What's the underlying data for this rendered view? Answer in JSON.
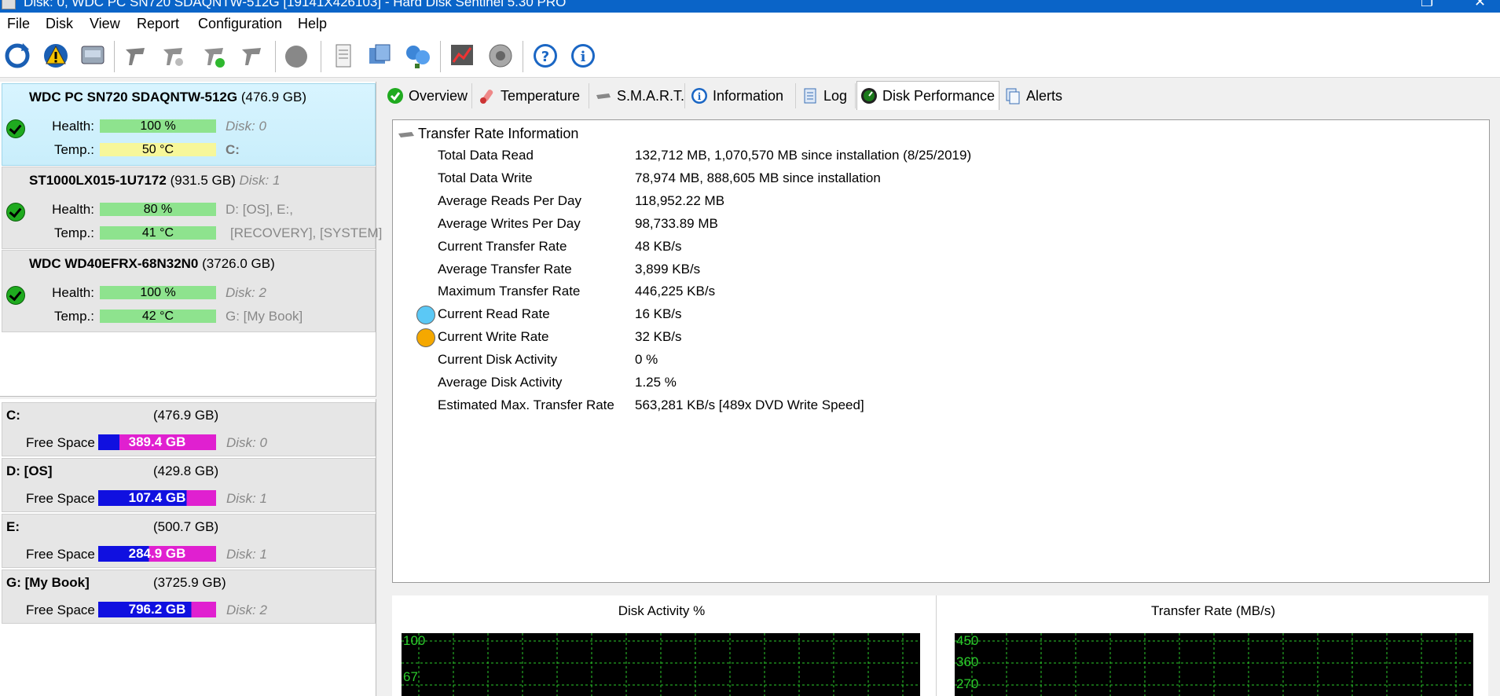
{
  "window": {
    "title": "Disk: 0, WDC PC SN720 SDAQNTW-512G [19141X426103]  -  Hard Disk Sentinel 5.30 PRO"
  },
  "menu": [
    "File",
    "Disk",
    "View",
    "Report",
    "Configuration",
    "Help"
  ],
  "toolbar": {
    "buttons": [
      "refresh-icon",
      "alert-icon",
      "disk-icon",
      "tool-icon",
      "tool-icon",
      "tool-icon",
      "tool-icon",
      "power-icon",
      "document-icon",
      "sync-icon",
      "network-icon",
      "chart-icon",
      "speaker-icon",
      "help-icon",
      "info-icon"
    ]
  },
  "disks": [
    {
      "name": "WDC PC SN720 SDAQNTW-512G",
      "size": "(476.9 GB)",
      "health_label": "Health:",
      "health": "100 %",
      "health_pct": 100,
      "temp_label": "Temp.:",
      "temp": "50 °C",
      "disk_no": "Disk: 0",
      "drives": "C:",
      "status": "ok"
    },
    {
      "name": "ST1000LX015-1U7172",
      "size": "(931.5 GB)",
      "disk_no": "Disk: 1",
      "health_label": "Health:",
      "health": "80 %",
      "health_pct": 80,
      "temp_label": "Temp.:",
      "temp": "41 °C",
      "drives_line1": "D: [OS], E:,",
      "drives_line2": "[RECOVERY],  [SYSTEM]",
      "status": "ok"
    },
    {
      "name": "WDC WD40EFRX-68N32N0",
      "size": "(3726.0 GB)",
      "health_label": "Health:",
      "health": "100 %",
      "health_pct": 100,
      "temp_label": "Temp.:",
      "temp": "42 °C",
      "disk_no": "Disk: 2",
      "drives": "G: [My Book]",
      "status": "ok"
    }
  ],
  "volumes": [
    {
      "name": "C:",
      "size": "(476.9 GB)",
      "free_label": "Free Space",
      "free": "389.4 GB",
      "free_pct": 82,
      "disk": "Disk: 0"
    },
    {
      "name": "D: [OS]",
      "size": "(429.8 GB)",
      "free_label": "Free Space",
      "free": "107.4 GB",
      "free_pct": 25,
      "disk": "Disk: 1"
    },
    {
      "name": "E:",
      "size": "(500.7 GB)",
      "free_label": "Free Space",
      "free": "284.9 GB",
      "free_pct": 57,
      "disk": "Disk: 1"
    },
    {
      "name": "G: [My Book]",
      "size": "(3725.9 GB)",
      "free_label": "Free Space",
      "free": "796.2 GB",
      "free_pct": 21,
      "disk": "Disk: 2"
    }
  ],
  "tabs": [
    {
      "label": "Overview",
      "active": false
    },
    {
      "label": "Temperature",
      "active": false
    },
    {
      "label": "S.M.A.R.T.",
      "active": false
    },
    {
      "label": "Information",
      "active": false
    },
    {
      "label": "Log",
      "active": false
    },
    {
      "label": "Disk Performance",
      "active": true
    },
    {
      "label": "Alerts",
      "active": false
    }
  ],
  "transfer": {
    "heading": "Transfer Rate Information",
    "rows": [
      {
        "k": "Total Data Read",
        "v": "132,712 MB,  1,070,570 MB since installation  (8/25/2019)"
      },
      {
        "k": "Total Data Write",
        "v": "78,974 MB,  888,605 MB since installation"
      },
      {
        "k": "Average Reads Per Day",
        "v": "118,952.22 MB"
      },
      {
        "k": "Average Writes Per Day",
        "v": "98,733.89 MB"
      },
      {
        "k": "Current Transfer Rate",
        "v": "48 KB/s"
      },
      {
        "k": "Average Transfer Rate",
        "v": "3,899 KB/s"
      },
      {
        "k": "Maximum Transfer Rate",
        "v": "446,225 KB/s"
      },
      {
        "k": "Current Read Rate",
        "v": "16 KB/s"
      },
      {
        "k": "Current Write Rate",
        "v": "32 KB/s"
      },
      {
        "k": "Current Disk Activity",
        "v": "0 %"
      },
      {
        "k": "Average Disk Activity",
        "v": "1.25 %"
      },
      {
        "k": "Estimated Max. Transfer Rate",
        "v": "563,281 KB/s [489x DVD Write Speed]"
      }
    ],
    "read_color": "#5bc8f5",
    "write_color": "#f5a800"
  },
  "charts": [
    {
      "title": "Disk Activity %",
      "y_labels": [
        "100",
        "67"
      ]
    },
    {
      "title": "Transfer Rate (MB/s)",
      "y_labels": [
        "450",
        "360",
        "270"
      ]
    }
  ],
  "colors": {
    "accent": "#0a64c8",
    "health_bar": "#8ee38e",
    "temp_bar": "#f7f79a",
    "free_bar_blue": "#1010e0",
    "free_bar_magenta": "#e020d0",
    "grid": "#2bcc2b"
  }
}
